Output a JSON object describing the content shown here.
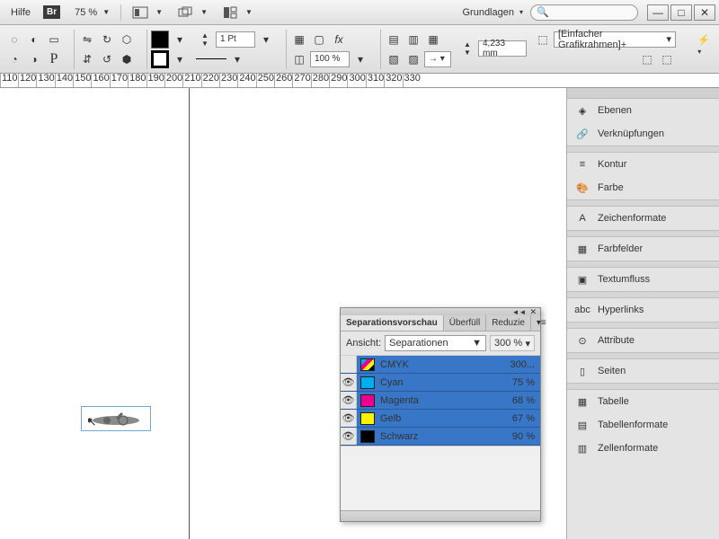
{
  "topbar": {
    "help": "Hilfe",
    "br": "Br",
    "zoom": "75 %",
    "basics": "Grundlagen"
  },
  "ctlbar": {
    "stroke_weight": "1 Pt",
    "opacity": "100 %",
    "frame_w": "4,233 mm",
    "frame_type": "[Einfacher Grafikrahmen]+"
  },
  "ruler": [
    "110",
    "120",
    "130",
    "140",
    "150",
    "160",
    "170",
    "180",
    "190",
    "200",
    "210",
    "220",
    "230",
    "240",
    "250",
    "260",
    "270",
    "280",
    "290",
    "300",
    "310",
    "320",
    "330"
  ],
  "sidepanel": {
    "items": [
      {
        "icon": "layers",
        "label": "Ebenen"
      },
      {
        "icon": "links",
        "label": "Verknüpfungen"
      },
      {
        "sep": true
      },
      {
        "icon": "stroke",
        "label": "Kontur"
      },
      {
        "icon": "color",
        "label": "Farbe"
      },
      {
        "sep": true
      },
      {
        "icon": "charstyle",
        "label": "Zeichenformate"
      },
      {
        "sep": true
      },
      {
        "icon": "swatches",
        "label": "Farbfelder"
      },
      {
        "sep": true
      },
      {
        "icon": "textwrap",
        "label": "Textumfluss"
      },
      {
        "sep": true
      },
      {
        "icon": "hyperlinks",
        "label": "Hyperlinks"
      },
      {
        "sep": true
      },
      {
        "icon": "attributes",
        "label": "Attribute"
      },
      {
        "sep": true
      },
      {
        "icon": "pages",
        "label": "Seiten"
      },
      {
        "sep": true
      },
      {
        "icon": "table",
        "label": "Tabelle"
      },
      {
        "icon": "tablefmt",
        "label": "Tabellenformate"
      },
      {
        "icon": "cellfmt",
        "label": "Zellenformate"
      }
    ]
  },
  "floatpanel": {
    "tabs": [
      "Separationsvorschau",
      "Überfüll",
      "Reduzie"
    ],
    "view_label": "Ansicht:",
    "view_value": "Separationen",
    "zoom": "300 %",
    "inks": [
      {
        "name": "CMYK",
        "val": "300...",
        "eye": false,
        "chip": "cmyk"
      },
      {
        "name": "Cyan",
        "val": "75 %",
        "eye": true,
        "chip": "#00aeef"
      },
      {
        "name": "Magenta",
        "val": "68 %",
        "eye": true,
        "chip": "#ec008c"
      },
      {
        "name": "Gelb",
        "val": "67 %",
        "eye": true,
        "chip": "#fff200"
      },
      {
        "name": "Schwarz",
        "val": "90 %",
        "eye": true,
        "chip": "#000000"
      }
    ]
  }
}
